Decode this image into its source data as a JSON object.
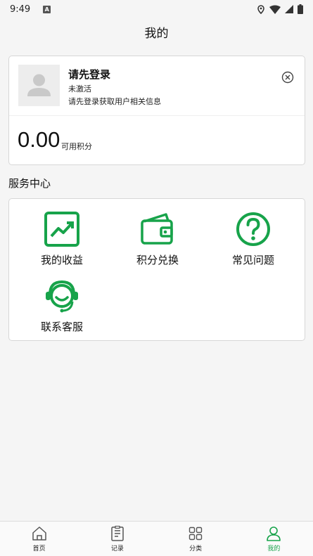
{
  "status_bar": {
    "time": "9:49",
    "a_badge": "A"
  },
  "app": {
    "title": "我的"
  },
  "profile": {
    "name": "请先登录",
    "status": "未激活",
    "hint": "请先登录获取用户相关信息",
    "points_value": "0.00",
    "points_label": "可用积分"
  },
  "services": {
    "title": "服务中心",
    "items": [
      {
        "label": "我的收益",
        "icon": "earnings-chart-icon"
      },
      {
        "label": "积分兑换",
        "icon": "wallet-icon"
      },
      {
        "label": "常见问题",
        "icon": "question-circle-icon"
      },
      {
        "label": "联系客服",
        "icon": "customer-service-icon"
      }
    ]
  },
  "nav": {
    "items": [
      {
        "label": "首页",
        "icon": "home-icon"
      },
      {
        "label": "记录",
        "icon": "record-icon"
      },
      {
        "label": "分类",
        "icon": "grid-category-icon"
      },
      {
        "label": "我的",
        "icon": "user-icon"
      }
    ],
    "active_index": 3
  },
  "colors": {
    "accent": "#17a34a",
    "background": "#f5f5f5",
    "card": "#ffffff"
  }
}
